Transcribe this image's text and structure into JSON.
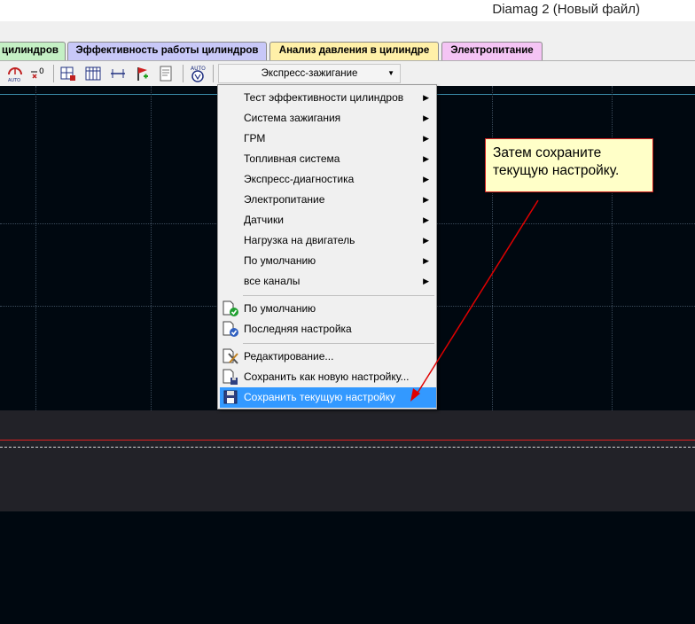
{
  "window": {
    "title": "Diamag 2 (Новый файл)"
  },
  "tabs": [
    {
      "label": "цилиндров"
    },
    {
      "label": "Эффективность работы цилиндров"
    },
    {
      "label": "Анализ давления в цилиндре"
    },
    {
      "label": "Электропитание"
    }
  ],
  "toolbar": {
    "icons": [
      "auto-scale-icon",
      "zero-offset-icon",
      "grid-icon",
      "table-icon",
      "cursor-icon",
      "flag-icon",
      "notes-icon",
      "auto-cylinder-icon"
    ],
    "icon_text": {
      "auto": "AUTO",
      "zero": "0"
    },
    "combo_value": "Экспресс-зажигание"
  },
  "menu": {
    "submenus": [
      {
        "label": "Тест эффективности цилиндров"
      },
      {
        "label": "Система зажигания"
      },
      {
        "label": "ГРМ"
      },
      {
        "label": "Топливная система"
      },
      {
        "label": "Экспресс-диагностика"
      },
      {
        "label": "Электропитание"
      },
      {
        "label": "Датчики"
      },
      {
        "label": "Нагрузка на двигатель"
      },
      {
        "label": "По умолчанию"
      },
      {
        "label": "все каналы"
      }
    ],
    "presets": [
      {
        "label": "По умолчанию",
        "icon": "document-green-check-icon"
      },
      {
        "label": "Последняя настройка",
        "icon": "document-blue-check-icon"
      }
    ],
    "actions": [
      {
        "label": "Редактирование...",
        "icon": "edit-tools-icon"
      },
      {
        "label": "Сохранить как новую настройку...",
        "icon": "save-as-icon"
      },
      {
        "label": "Сохранить текущую настройку",
        "icon": "floppy-disk-icon",
        "selected": true
      }
    ]
  },
  "callout": {
    "text": "Затем сохраните текущую настройку."
  },
  "colors": {
    "accent_selection": "#3399ff",
    "callout_border": "#d02020",
    "arrow": "#e00000",
    "plot_bg": "#000810"
  }
}
